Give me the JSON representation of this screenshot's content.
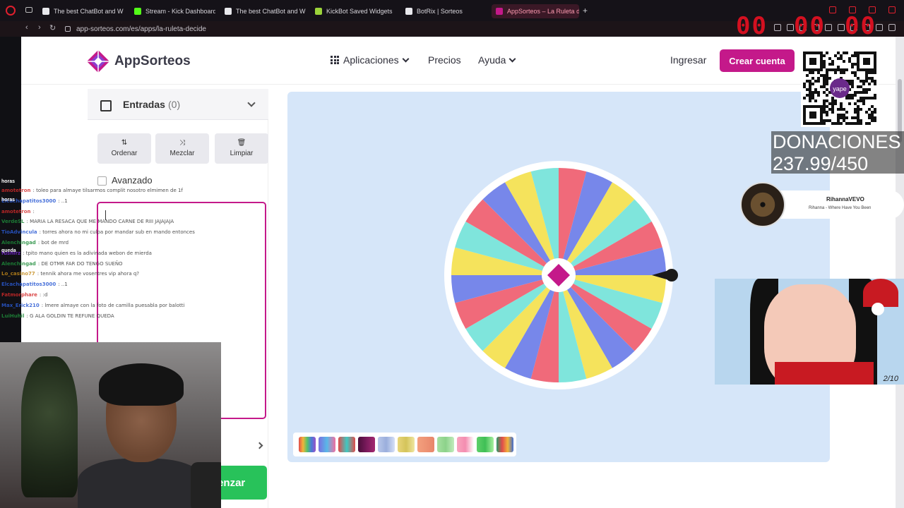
{
  "browser": {
    "tabs": [
      {
        "label": "The best ChatBot and Wi",
        "color": "#e8e8ec"
      },
      {
        "label": "Stream - Kick Dashboard",
        "color": "#53fc18"
      },
      {
        "label": "The best ChatBot and Wi",
        "color": "#e8e8ec"
      },
      {
        "label": "KickBot Saved Widgets",
        "color": "#9bd33a"
      },
      {
        "label": "BotRix | Sorteos",
        "color": "#e8e8ec"
      },
      {
        "label": "AppSorteos – La Ruleta d",
        "color": "#c4198a"
      }
    ],
    "new_tab": "+",
    "url": "app-sorteos.com/es/apps/la-ruleta-decide",
    "overlay_counter_left": "00",
    "overlay_counter_mid": "00",
    "overlay_counter_right": "00"
  },
  "header": {
    "logo": "AppSorteos",
    "nav": {
      "apps": "Aplicaciones",
      "prices": "Precios",
      "help": "Ayuda"
    },
    "login": "Ingresar",
    "signup": "Crear cuenta"
  },
  "panel": {
    "title": "Entradas",
    "count": "(0)",
    "buttons": {
      "sort": "Ordenar",
      "shuffle": "Mezclar",
      "clear": "Limpiar"
    },
    "advanced": "Avanzado",
    "start": "menzar"
  },
  "wheel": {
    "segment_colors": [
      "#f06a7a",
      "#7787ea",
      "#f5e35c",
      "#7fe5dc"
    ],
    "segments": 24,
    "center_color": "#c4198a",
    "pointer_color": "#1a1a1a"
  },
  "palette": {
    "swatches": [
      [
        "#e04b4b",
        "#f2b53a",
        "#54c26b",
        "#4a7ad8",
        "#9a51c8"
      ],
      [
        "#7a6fe0",
        "#59b8e8",
        "#f16ea0"
      ],
      [
        "#e04b4b",
        "#3fc9c2",
        "#e04b4b"
      ],
      [
        "#4b0e3a",
        "#7a1a5c",
        "#a3286f"
      ],
      [
        "#b9c7ea",
        "#9aaedc",
        "#d6e0f7"
      ],
      [
        "#e8d57a",
        "#d4c45a",
        "#efe6a0"
      ],
      [
        "#f3a07e",
        "#e8866a"
      ],
      [
        "#a7e0a0",
        "#8cd28a",
        "#c2ecbd"
      ],
      [
        "#f8a5bf",
        "#f48db0",
        "#ffffff"
      ],
      [
        "#5fd06a",
        "#3fbf55",
        "#a8f0a0"
      ],
      [
        "#2b9b6a",
        "#e04b4b",
        "#f2b53a",
        "#3f6bd0"
      ]
    ]
  },
  "overlay": {
    "chat": [
      {
        "user": "amotetron",
        "text": ": toleo para almaye tilsarmos complit nosotro elmimen de 1f",
        "color": "#d42a2a"
      },
      {
        "user": "Elcachapatitos3000",
        "text": ": ..1",
        "color": "#2a5ad4"
      },
      {
        "user": "amotetron",
        "text": ":",
        "color": "#d42a2a"
      },
      {
        "user": "VerdeSL",
        "text": ": MARIA LA RESACA QUE ME MANDO CARNE DE RIII JAJAJAJA",
        "color": "#1e8c3a"
      },
      {
        "user": "TioAdvincula",
        "text": ": torres ahora no mi culpa por mandar sub en mando entonces",
        "color": "#2a5ad4"
      },
      {
        "user": "Alenchingad",
        "text": ": bot de mrd",
        "color": "#1e8c3a"
      },
      {
        "user": "fushirz",
        "text": ": tpito mano quien es la adivinada webon de mierda",
        "color": "#7a2ad4"
      },
      {
        "user": "Alenchingad",
        "text": ": DE OTMR FAR DO TENGO SUEÑO",
        "color": "#1e8c3a"
      },
      {
        "user": "Lo_casino77",
        "text": ": tennik ahora me vosentres vip ahora q?",
        "color": "#c48a1a"
      },
      {
        "user": "Elcachapatitos3000",
        "text": ": ..1",
        "color": "#2a5ad4"
      },
      {
        "user": "Fatmorphare",
        "text": ": :d",
        "color": "#d42a2a"
      },
      {
        "user": "Max_Erick210",
        "text": ": lmere almaye con la foto de camilla puesabla por balotti",
        "color": "#2a5ad4"
      },
      {
        "user": "LuiHuhil",
        "text": ": G ALA GOLDIN TE REFUNE QUEDA",
        "color": "#1e8c3a"
      }
    ],
    "side_labels": [
      "horas",
      "horas",
      "queda"
    ],
    "donations_title": "DONACIONES",
    "donations_value": "237.99/450",
    "music_artist": "RihannaVEVO",
    "music_track": "Rihanna - Where Have You Been",
    "qr_label": "yape",
    "drawing_signature": "2/10"
  }
}
